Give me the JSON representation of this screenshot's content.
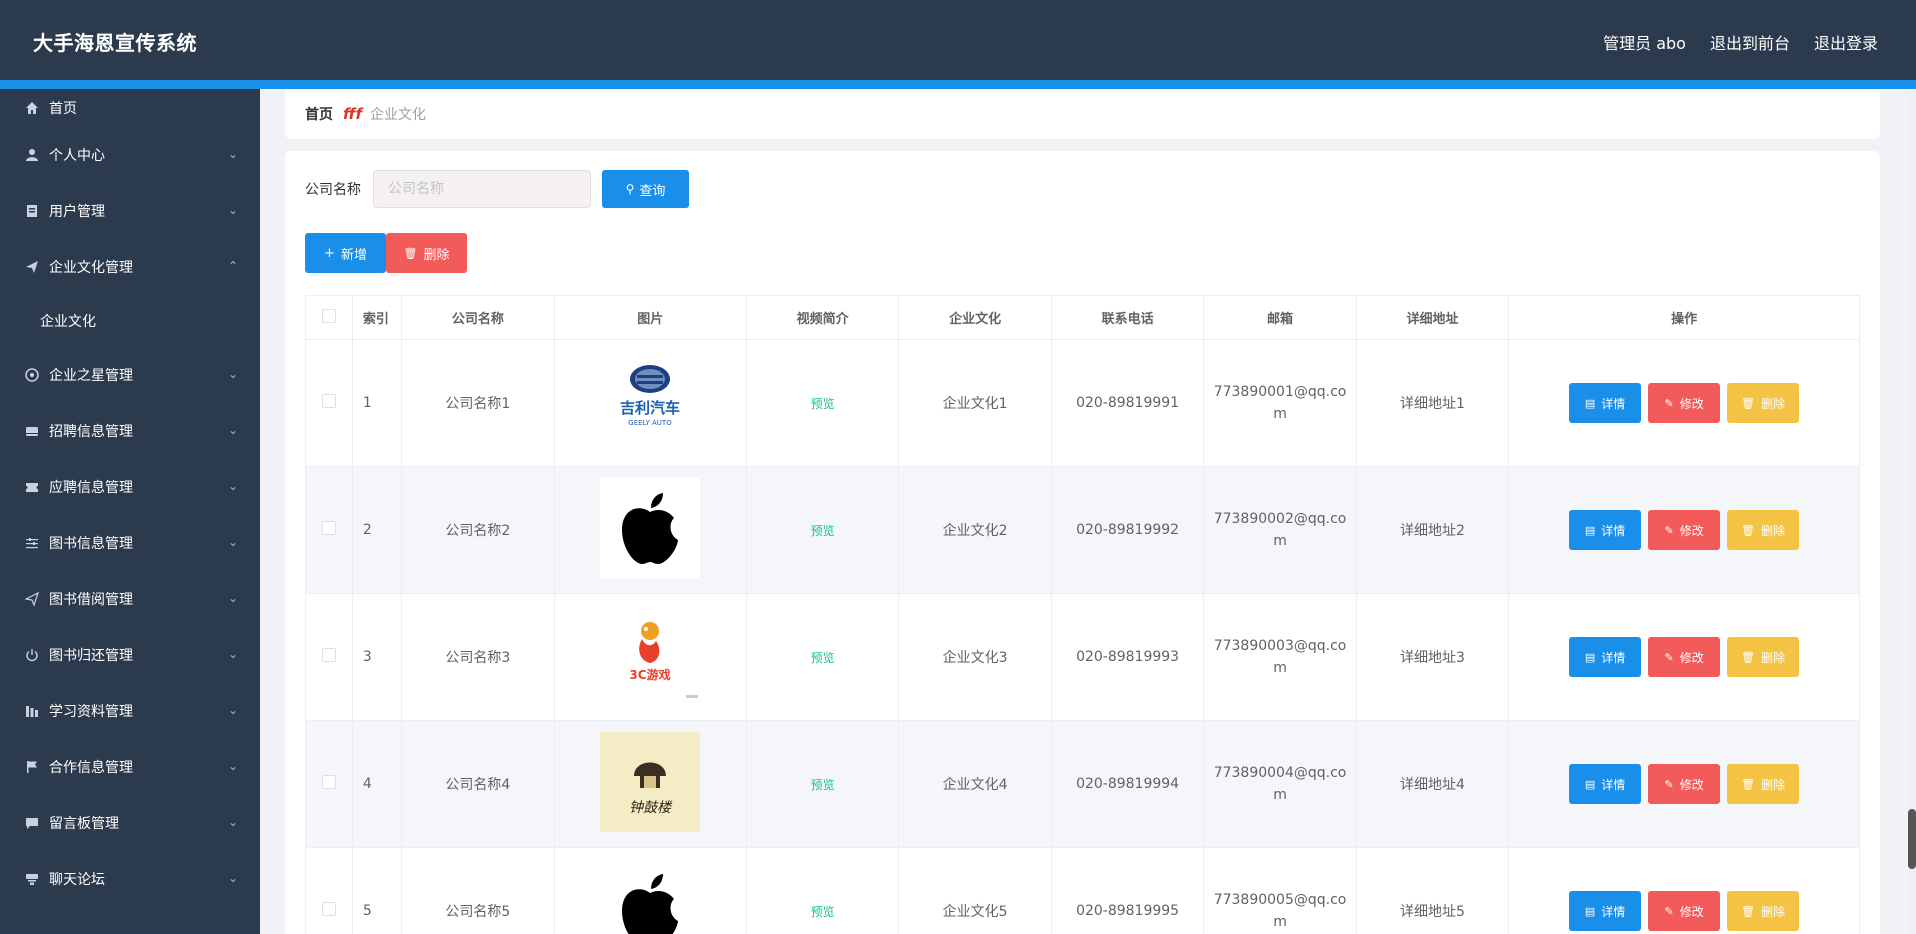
{
  "header": {
    "title": "大手海恩宣传系统",
    "admin": "管理员 abo",
    "to_front": "退出到前台",
    "logout": "退出登录"
  },
  "sidebar": {
    "items": [
      {
        "label": "首页",
        "icon": "home-icon"
      },
      {
        "label": "个人中心",
        "icon": "user-icon"
      },
      {
        "label": "用户管理",
        "icon": "clipboard-icon"
      },
      {
        "label": "企业文化管理",
        "icon": "send-icon",
        "expanded": true
      },
      {
        "label": "企业文化",
        "sub": true
      },
      {
        "label": "企业之星管理",
        "icon": "target-icon"
      },
      {
        "label": "招聘信息管理",
        "icon": "folder-icon"
      },
      {
        "label": "应聘信息管理",
        "icon": "ticket-icon"
      },
      {
        "label": "图书信息管理",
        "icon": "sliders-icon"
      },
      {
        "label": "图书借阅管理",
        "icon": "send-icon"
      },
      {
        "label": "图书归还管理",
        "icon": "power-icon"
      },
      {
        "label": "学习资料管理",
        "icon": "bars-icon"
      },
      {
        "label": "合作信息管理",
        "icon": "flag-icon"
      },
      {
        "label": "留言板管理",
        "icon": "chat-icon"
      },
      {
        "label": "聊天论坛",
        "icon": "stamp-icon"
      }
    ]
  },
  "breadcrumb": {
    "home": "首页",
    "current": "企业文化"
  },
  "search": {
    "label": "公司名称",
    "placeholder": "公司名称",
    "button": "查询"
  },
  "actions": {
    "add": "新增",
    "delete": "删除"
  },
  "table": {
    "headers": [
      "索引",
      "公司名称",
      "图片",
      "视频简介",
      "企业文化",
      "联系电话",
      "邮箱",
      "详细地址",
      "操作"
    ],
    "rows": [
      {
        "index": "1",
        "name": "公司名称1",
        "image": "geely-logo",
        "video": "预览",
        "culture": "企业文化1",
        "phone": "020-89819991",
        "email": "773890001@qq.com",
        "address": "详细地址1"
      },
      {
        "index": "2",
        "name": "公司名称2",
        "image": "apple-logo",
        "video": "预览",
        "culture": "企业文化2",
        "phone": "020-89819992",
        "email": "773890002@qq.com",
        "address": "详细地址2"
      },
      {
        "index": "3",
        "name": "公司名称3",
        "image": "3c-logo",
        "video": "预览",
        "culture": "企业文化3",
        "phone": "020-89819993",
        "email": "773890003@qq.com",
        "address": "详细地址3"
      },
      {
        "index": "4",
        "name": "公司名称4",
        "image": "tower-logo",
        "video": "预览",
        "culture": "企业文化4",
        "phone": "020-89819994",
        "email": "773890004@qq.com",
        "address": "详细地址4"
      },
      {
        "index": "5",
        "name": "公司名称5",
        "image": "apple-logo",
        "video": "预览",
        "culture": "企业文化5",
        "phone": "020-89819995",
        "email": "773890005@qq.com",
        "address": "详细地址5"
      }
    ],
    "ops": {
      "detail": "详情",
      "edit": "修改",
      "delete": "删除"
    }
  },
  "logo_text": {
    "geely_cn": "吉利汽车",
    "geely_en": "GEELY AUTO",
    "game": "3C游戏",
    "tower": "钟鼓楼"
  },
  "colors": {
    "topbar": "#2c3a4e",
    "accent": "#1a8fea",
    "danger": "#f35a5a",
    "warning": "#f5c344",
    "preview": "#18c28c"
  }
}
